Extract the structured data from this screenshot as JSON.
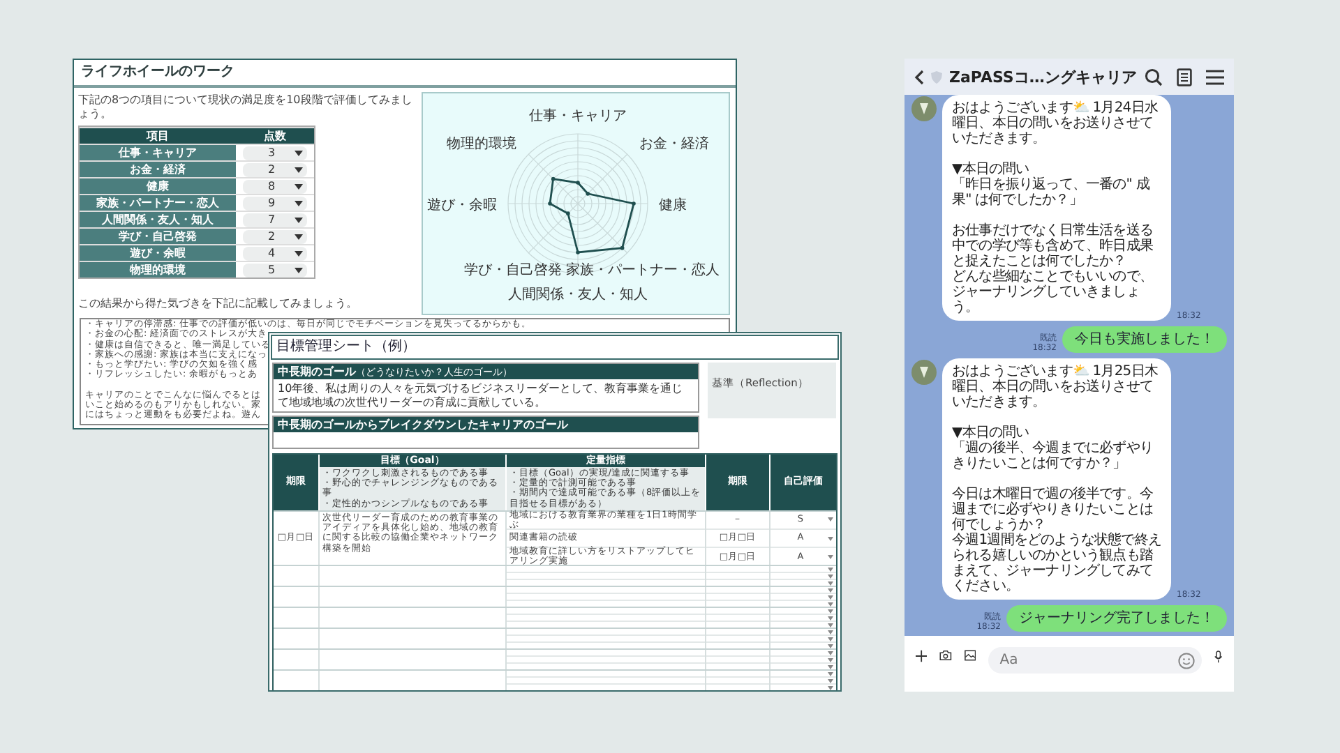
{
  "life_wheel_sheet": {
    "title": "ライフホイールのワーク",
    "instruction": "下記の8つの項目について現状の満足度を10段階で評価してみましょう。",
    "table": {
      "columns": [
        "項目",
        "点数"
      ],
      "rows": [
        {
          "item": "仕事・キャリア",
          "score": "3"
        },
        {
          "item": "お金・経済",
          "score": "2"
        },
        {
          "item": "健康",
          "score": "8"
        },
        {
          "item": "家族・パートナー・恋人",
          "score": "9"
        },
        {
          "item": "人間関係・友人・知人",
          "score": "7"
        },
        {
          "item": "学び・自己啓発",
          "score": "2"
        },
        {
          "item": "遊び・余暇",
          "score": "4"
        },
        {
          "item": "物理的環境",
          "score": "5"
        }
      ]
    },
    "radar_chart": {
      "axis_labels": [
        "仕事・キャリア",
        "お金・経済",
        "健康",
        "家族・パートナー・恋人",
        "人間関係・友人・知人",
        "学び・自己啓発",
        "遊び・余暇",
        "物理的環境"
      ]
    },
    "memo_prompt": "この結果から得た気づきを下記に記載してみましょう。",
    "memo_paragraphs": [
      [
        "・キャリアの停滞感: 仕事での評価が低いのは、毎日が同じでモチベーションを見失ってるからかも。",
        "・お金の心配: 経済面でのストレスが大き",
        "・健康は自信できると、唯一満足している",
        "・家族への感謝: 家族は本当に支えになっ",
        "・もっと学びたい: 学びの欠如を強く感",
        "・リフレッシュしたい: 余暇がもっとあ"
      ],
      [
        "キャリアのことでこんなに悩んでるとは",
        "いこと始めるのもアリかもしれない。家",
        "にはちょっと運動をも必要だよね。遊ん"
      ]
    ]
  },
  "goal_sheet": {
    "title": "目標管理シート（例）",
    "long_term_goal": {
      "heading": "中長期のゴール",
      "subheading": "（どうなりたいか？人生のゴール）",
      "text": "10年後、私は周りの人々を元気づけるビジネスリーダーとして、教育事業を通じて地域地域の次世代リーダーの育成に貢献している。"
    },
    "career_goal": {
      "heading": "中長期のゴールからブレイクダウンしたキャリアのゴール"
    },
    "reflection": {
      "heading": "基準（Reflection）"
    },
    "table": {
      "columns": [
        {
          "label": "期限"
        },
        {
          "label": "目標（Goal）",
          "notes": [
            "・ワクワクし刺激されるものである事",
            "・野心的でチャレンジングなものである事",
            "・定性的かつシンプルなものである事"
          ]
        },
        {
          "label": "定量指標",
          "notes": [
            "・目標（Goal）の実現/達成に関連する事",
            "・定量的で計測可能である事",
            "・期間内で達成可能である事（8評価以上を目指せる目標がある）"
          ]
        },
        {
          "label": "期限"
        },
        {
          "label": "自己評価"
        }
      ],
      "rows": [
        {
          "deadline": "□月□日",
          "goal": "次世代リーダー育成のための教育事業のアイディアを具体化し始め、地域の教育に関する比較の協働企業やネットワーク構築を開始",
          "indicators": [
            {
              "text": "地域における教育業界の業種を1日1時間学ぶ",
              "deadline": "－",
              "rating": "S"
            },
            {
              "text": "関連書籍の読破",
              "deadline": "□月□日",
              "rating": "A"
            },
            {
              "text": "地域教育に詳しい方をリストアップしてヒアリング実施",
              "deadline": "□月□日",
              "rating": "A"
            }
          ]
        }
      ]
    }
  },
  "chat": {
    "title": "ZaPASSコ…ングキャリア",
    "messages": [
      {
        "kind": "received",
        "paragraphs": [
          [
            "おはようございます⛅ 1月24日水曜日、本日の問いをお送りさせていただきます。"
          ],
          [
            "▼本日の問い",
            "「昨日を振り返って、一番の\" 成果\" は何でしたか？」"
          ],
          [
            "お仕事だけでなく日常生活を送る中での学び等も含めて、昨日成果と捉えたことは何でしたか？",
            "どんな些細なことでもいいので、ジャーナリングしていきましょう。"
          ]
        ],
        "time": "18:32"
      },
      {
        "kind": "sent",
        "text": "今日も実施しました！",
        "read": "既読",
        "time": "18:32"
      },
      {
        "kind": "received",
        "paragraphs": [
          [
            "おはようございます⛅ 1月25日木曜日、本日の問いをお送りさせていただきます。"
          ],
          [
            "▼本日の問い",
            "「週の後半、今週までに必ずやりきりたいことは何ですか？」"
          ],
          [
            "今日は木曜日で週の後半です。今週までに必ずやりきりたいことは何でしょうか？",
            "今週1週間をどのような状態で終えられる嬉しいのかという観点も踏まえて、ジャーナリングしてみてください。"
          ]
        ],
        "time": "18:32"
      },
      {
        "kind": "sent",
        "text": "ジャーナリング完了しました！",
        "read": "既読",
        "time": "18:32"
      }
    ],
    "input": {
      "placeholder": "Aa"
    }
  }
}
